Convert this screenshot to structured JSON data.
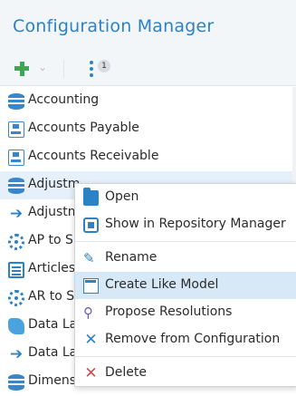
{
  "header": {
    "title": "Configuration Manager",
    "more_badge": "1"
  },
  "tree": {
    "items": [
      {
        "label": "Accounting",
        "icon": "database-icon"
      },
      {
        "label": "Accounts Payable",
        "icon": "model-icon"
      },
      {
        "label": "Accounts Receivable",
        "icon": "model-icon"
      },
      {
        "label": "Adjustm",
        "icon": "database-icon"
      },
      {
        "label": "Adjustm",
        "icon": "arrow-right-icon"
      },
      {
        "label": "AP to S",
        "icon": "gear-icon"
      },
      {
        "label": "Articles",
        "icon": "document-icon"
      },
      {
        "label": "AR to S",
        "icon": "gear-icon"
      },
      {
        "label": "Data La",
        "icon": "lake-icon"
      },
      {
        "label": "Data La",
        "icon": "arrow-right-icon"
      },
      {
        "label": "Dimens",
        "icon": "database-icon"
      }
    ]
  },
  "context_menu": {
    "open": "Open",
    "show_in_repository": "Show in Repository Manager",
    "rename": "Rename",
    "create_like_model": "Create Like Model",
    "propose_resolutions": "Propose Resolutions",
    "remove_from_configuration": "Remove from Configuration",
    "delete": "Delete"
  },
  "colors": {
    "accent": "#2b82c5",
    "add": "#3aa956",
    "delete": "#d24b4b",
    "highlight": "#d7e9f7"
  }
}
